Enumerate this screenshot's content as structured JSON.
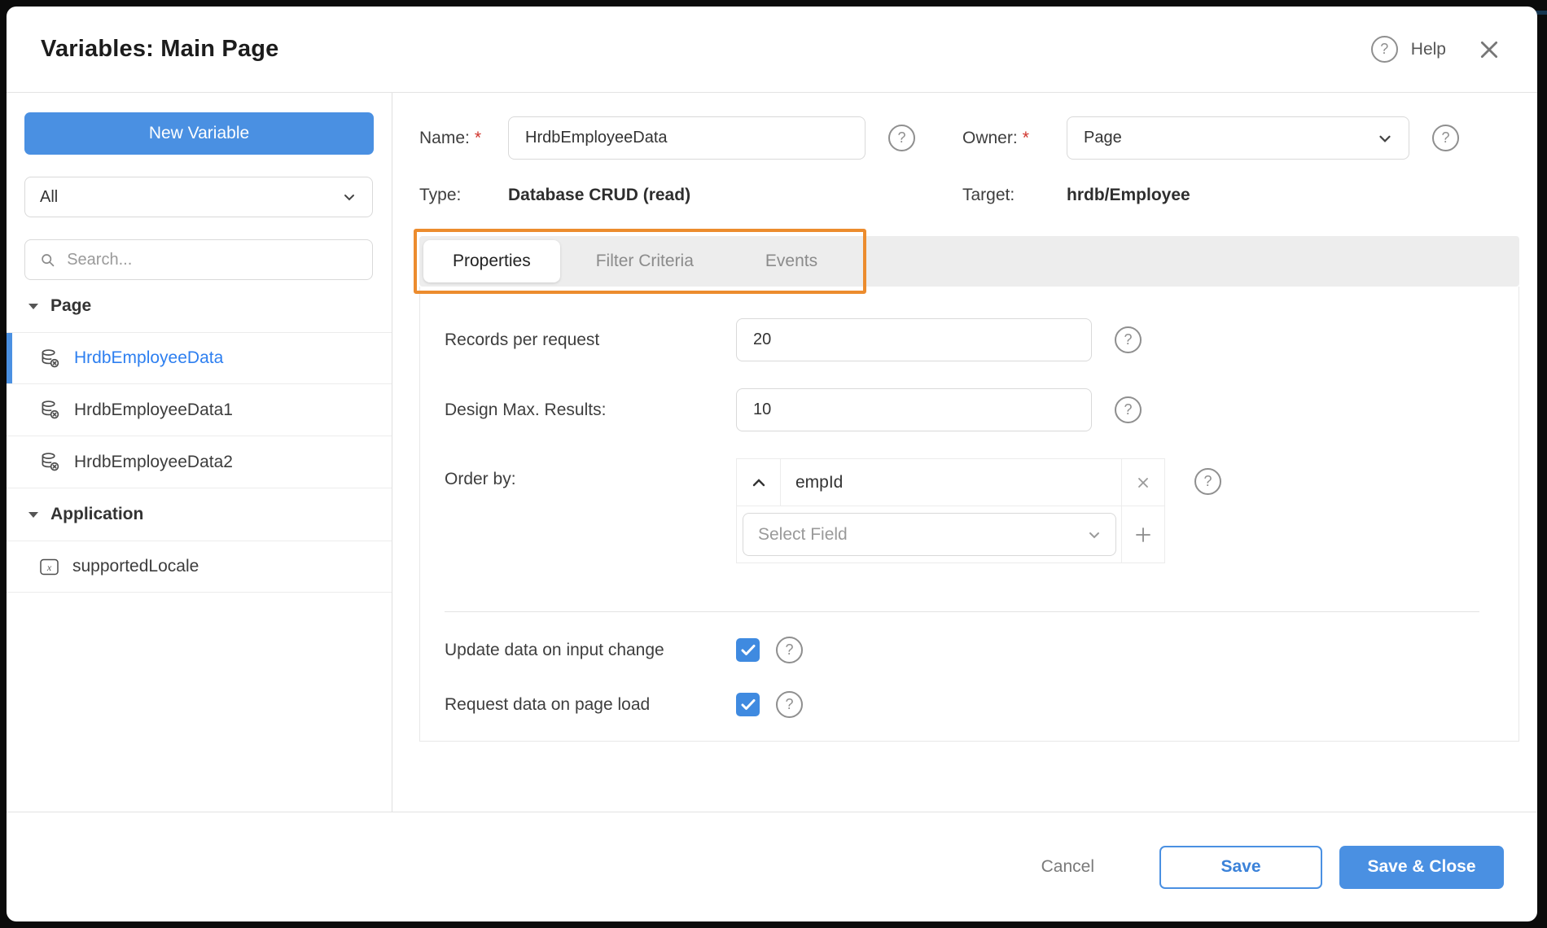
{
  "dialog": {
    "title": "Variables: Main Page",
    "help_label": "Help"
  },
  "icons": {
    "help_glyph": "?"
  },
  "colors": {
    "accent_blue": "#4a90e2",
    "highlight_orange": "#ec8c2e",
    "selected_item_blue": "#2d7ff0"
  },
  "sidebar": {
    "new_variable_button": "New Variable",
    "filter_value": "All",
    "search_placeholder": "Search...",
    "sections": [
      {
        "label": "Page",
        "items": [
          {
            "label": "HrdbEmployeeData",
            "icon": "database-crud",
            "selected": true
          },
          {
            "label": "HrdbEmployeeData1",
            "icon": "database-crud",
            "selected": false
          },
          {
            "label": "HrdbEmployeeData2",
            "icon": "database-crud",
            "selected": false
          }
        ]
      },
      {
        "label": "Application",
        "items": [
          {
            "label": "supportedLocale",
            "icon": "model-variable",
            "selected": false
          }
        ]
      }
    ]
  },
  "form": {
    "name": {
      "label": "Name:",
      "required": "*",
      "value": "HrdbEmployeeData"
    },
    "owner": {
      "label": "Owner:",
      "required": "*",
      "value": "Page"
    },
    "type": {
      "label": "Type:",
      "value": "Database CRUD (read)"
    },
    "target": {
      "label": "Target:",
      "value": "hrdb/Employee"
    }
  },
  "tabs": [
    {
      "label": "Properties",
      "active": true
    },
    {
      "label": "Filter Criteria",
      "active": false
    },
    {
      "label": "Events",
      "active": false
    }
  ],
  "properties": {
    "records": {
      "label": "Records per request",
      "value": "20"
    },
    "design": {
      "label": "Design Max. Results:",
      "value": "10"
    },
    "order_by": {
      "label": "Order by:",
      "field_value": "empId",
      "select_placeholder": "Select Field"
    },
    "update_on_input": {
      "label": "Update data on input change",
      "checked": true
    },
    "request_on_load": {
      "label": "Request data on page load",
      "checked": true
    }
  },
  "footer": {
    "cancel_label": "Cancel",
    "save_label": "Save",
    "save_close_label": "Save & Close"
  }
}
